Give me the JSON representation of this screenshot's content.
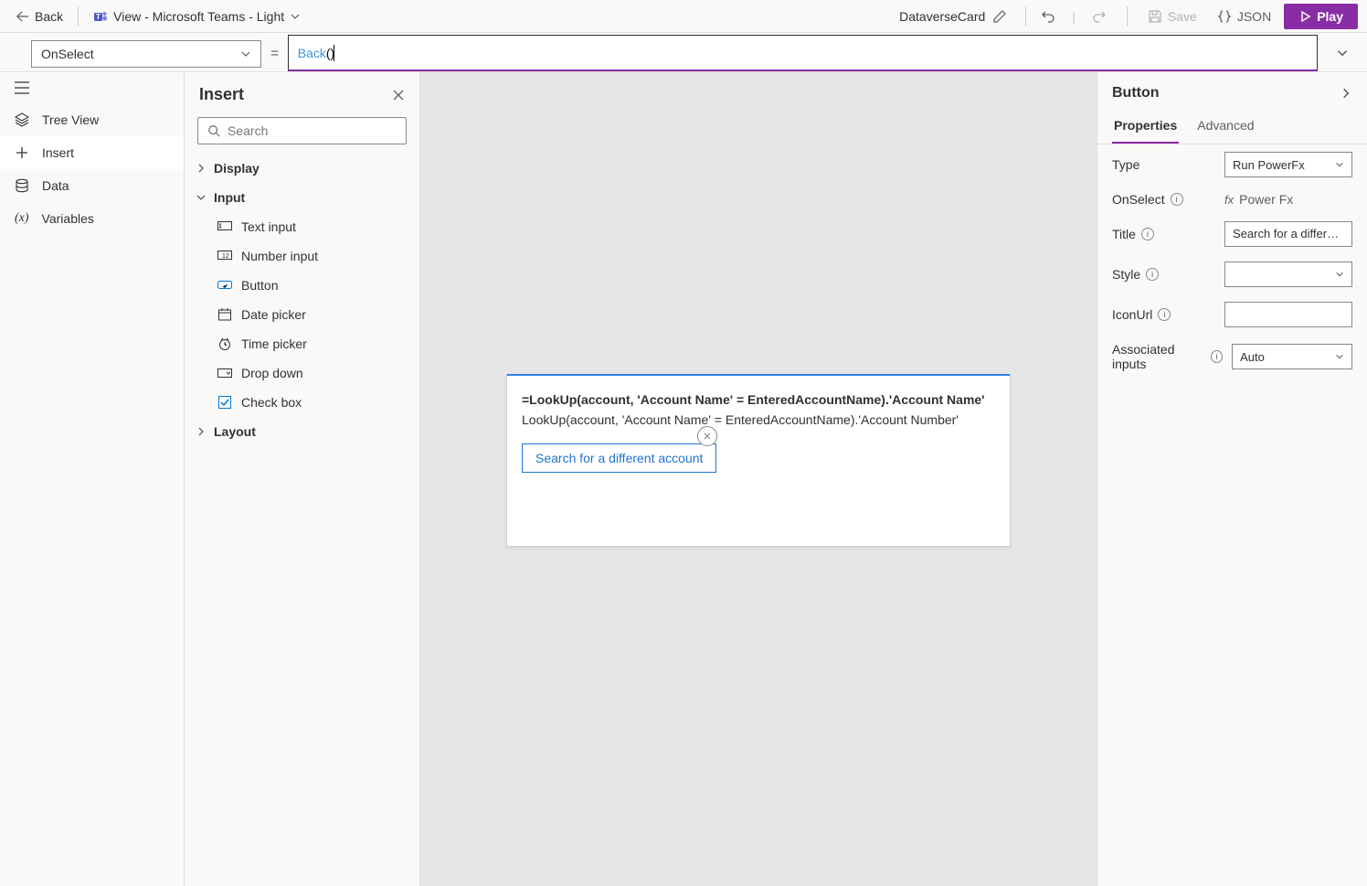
{
  "top": {
    "back": "Back",
    "view_label": "View - Microsoft Teams - Light",
    "card_name": "DataverseCard",
    "save": "Save",
    "json": "JSON",
    "play": "Play"
  },
  "formula": {
    "property": "OnSelect",
    "equals": "=",
    "func": "Back",
    "body": "()"
  },
  "rail": {
    "tree_view": "Tree View",
    "insert": "Insert",
    "data": "Data",
    "variables": "Variables"
  },
  "insert_panel": {
    "title": "Insert",
    "search_placeholder": "Search",
    "groups": {
      "display": "Display",
      "input": "Input",
      "layout": "Layout"
    },
    "input_items": {
      "text_input": "Text input",
      "number_input": "Number input",
      "button": "Button",
      "date_picker": "Date picker",
      "time_picker": "Time picker",
      "drop_down": "Drop down",
      "check_box": "Check box"
    }
  },
  "canvas": {
    "line1": "=LookUp(account, 'Account Name' = EnteredAccountName).'Account Name'",
    "line2": "LookUp(account, 'Account Name' = EnteredAccountName).'Account Number'",
    "button_label": "Search for a different account"
  },
  "props": {
    "title": "Button",
    "tabs": {
      "properties": "Properties",
      "advanced": "Advanced"
    },
    "rows": {
      "type": {
        "label": "Type",
        "value": "Run PowerFx"
      },
      "onselect": {
        "label": "OnSelect",
        "link": "Power Fx"
      },
      "title": {
        "label": "Title",
        "value": "Search for a different account"
      },
      "style": {
        "label": "Style",
        "value": ""
      },
      "iconurl": {
        "label": "IconUrl",
        "value": ""
      },
      "assoc": {
        "label": "Associated inputs",
        "value": "Auto"
      }
    }
  }
}
